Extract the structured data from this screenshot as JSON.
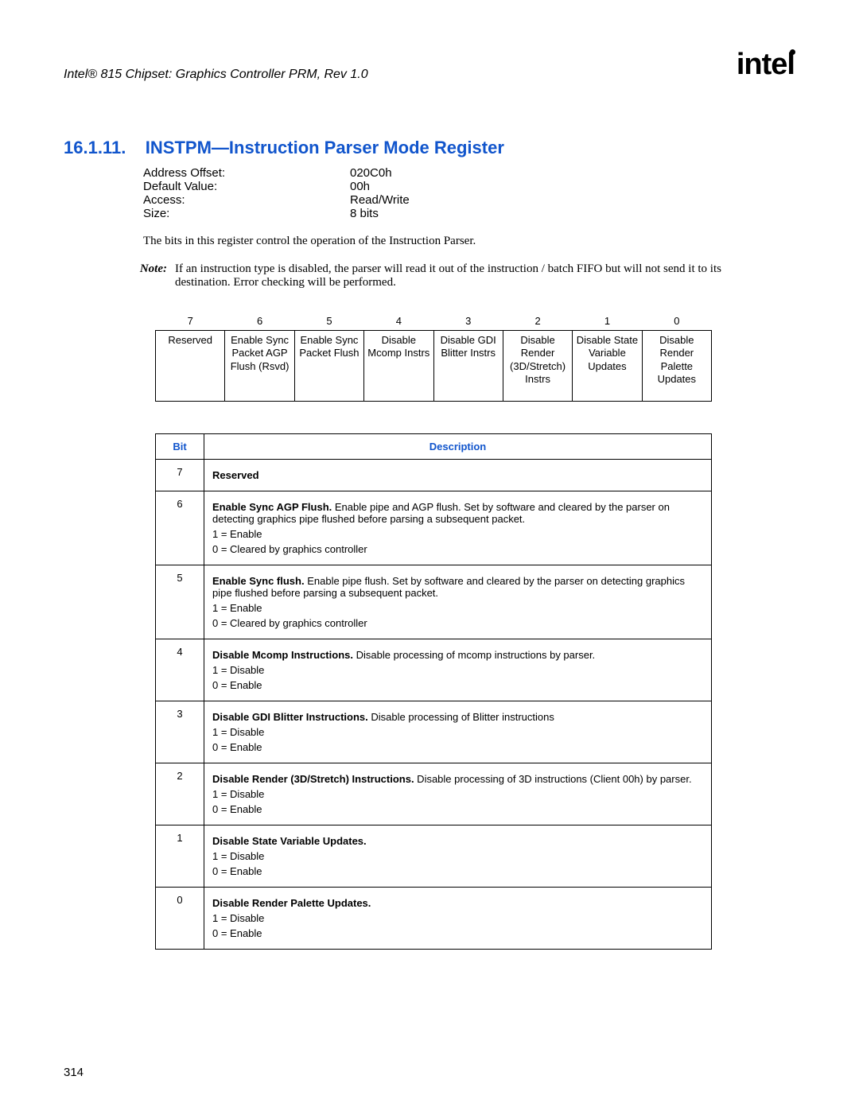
{
  "header": {
    "doc_title": "Intel® 815 Chipset: Graphics Controller PRM, Rev 1.0",
    "logo_text": "intel"
  },
  "section": {
    "number": "16.1.11.",
    "title": "INSTPM—Instruction Parser Mode Register"
  },
  "info": {
    "rows": [
      {
        "label": "Address Offset:",
        "value": "020C0h"
      },
      {
        "label": "Default Value:",
        "value": "00h"
      },
      {
        "label": "Access:",
        "value": "Read/Write"
      },
      {
        "label": "Size:",
        "value": "8 bits"
      }
    ]
  },
  "body_text": "The bits in this register control the operation of the Instruction Parser.",
  "note": {
    "label": "Note:",
    "text": "If an instruction type is disabled, the parser will read it out of the instruction / batch FIFO but will not send it to its destination. Error checking will be performed."
  },
  "bit_diagram": {
    "bit_numbers": [
      "7",
      "6",
      "5",
      "4",
      "3",
      "2",
      "1",
      "0"
    ],
    "labels": [
      "Reserved",
      "Enable Sync Packet AGP Flush (Rsvd)",
      "Enable Sync Packet Flush",
      "Disable Mcomp Instrs",
      "Disable GDI Blitter Instrs",
      "Disable Render (3D/Stretch) Instrs",
      "Disable State Variable Updates",
      "Disable Render Palette Updates"
    ]
  },
  "desc_table": {
    "headers": {
      "bit": "Bit",
      "desc": "Description"
    },
    "rows": [
      {
        "bit": "7",
        "bold": "Reserved",
        "lines": []
      },
      {
        "bit": "6",
        "bold": "Enable Sync AGP Flush.",
        "rest": " Enable pipe and AGP flush. Set by software and cleared by the parser on detecting graphics pipe flushed before parsing a subsequent packet.",
        "lines": [
          "1 = Enable",
          "0 = Cleared by graphics controller"
        ]
      },
      {
        "bit": "5",
        "bold": "Enable Sync flush.",
        "rest": " Enable pipe flush. Set by software and cleared by the parser on detecting graphics pipe flushed before parsing a subsequent packet.",
        "lines": [
          "1 = Enable",
          "0 = Cleared by graphics controller"
        ]
      },
      {
        "bit": "4",
        "bold": "Disable Mcomp Instructions.",
        "rest": " Disable processing of mcomp instructions by parser.",
        "lines": [
          "1 = Disable",
          "0 = Enable"
        ]
      },
      {
        "bit": "3",
        "bold": "Disable GDI Blitter Instructions.",
        "rest": " Disable processing of Blitter instructions",
        "lines": [
          "1 = Disable",
          "0 = Enable"
        ]
      },
      {
        "bit": "2",
        "bold": "Disable Render (3D/Stretch) Instructions.",
        "rest": " Disable processing of 3D instructions (Client 00h) by parser.",
        "lines": [
          "1 = Disable",
          "0 = Enable"
        ]
      },
      {
        "bit": "1",
        "bold": "Disable State Variable Updates.",
        "rest": "",
        "lines": [
          "1 = Disable",
          "0 = Enable"
        ]
      },
      {
        "bit": "0",
        "bold": "Disable Render Palette Updates.",
        "rest": "",
        "lines": [
          "1 = Disable",
          "0 = Enable"
        ]
      }
    ]
  },
  "page_number": "314"
}
